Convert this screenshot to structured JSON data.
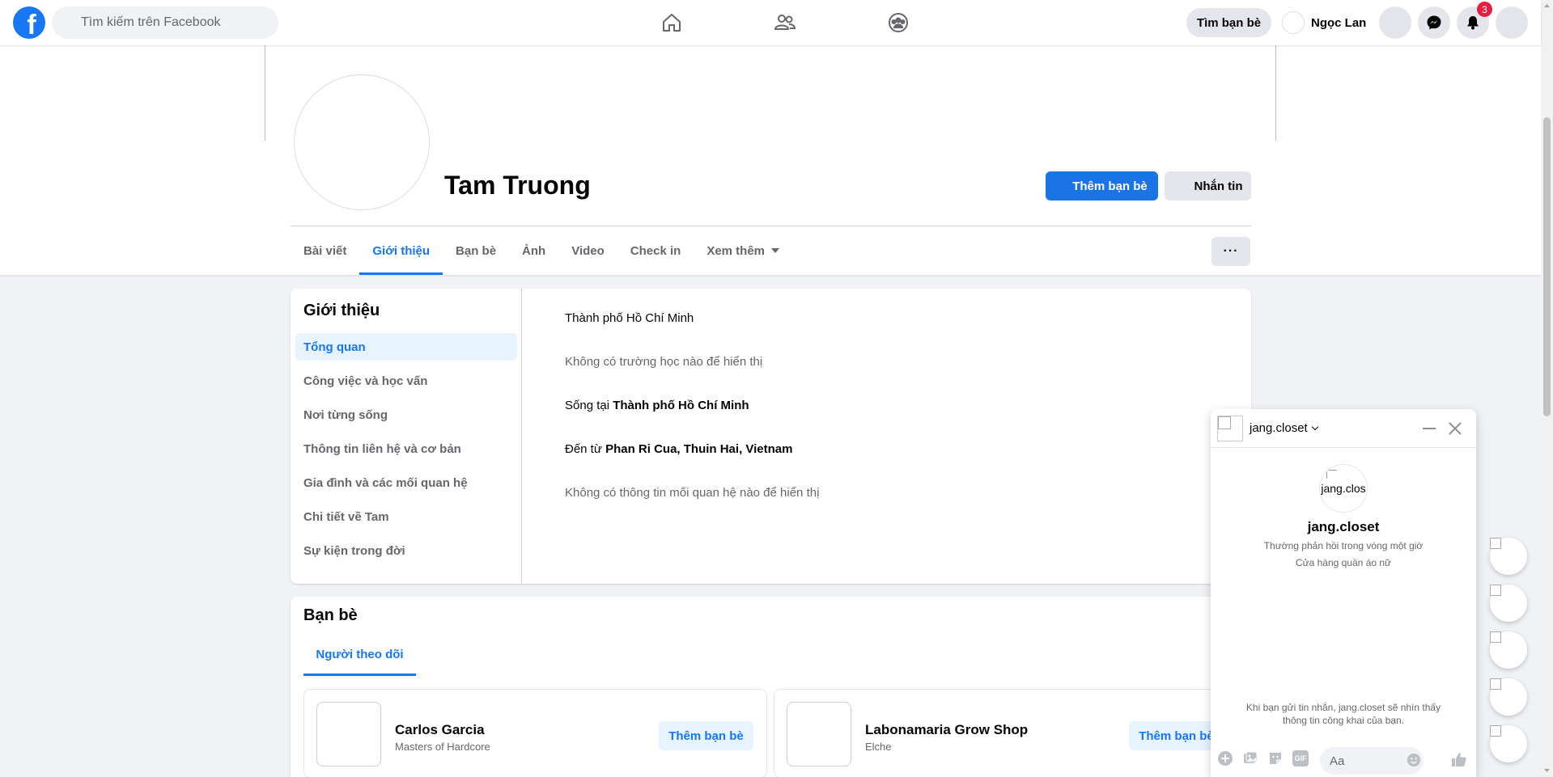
{
  "topbar": {
    "logo_letter": "f",
    "search_placeholder": "Tìm kiếm trên Facebook",
    "find_friends_label": "Tìm bạn bè",
    "user_name": "Ngọc Lan",
    "notification_count": "3",
    "nav_icons": [
      "home-icon",
      "friends-icon",
      "groups-icon"
    ]
  },
  "profile": {
    "name": "Tam Truong",
    "add_friend_label": "Thêm bạn bè",
    "message_label": "Nhắn tin",
    "tabs": [
      "Bài viết",
      "Giới thiệu",
      "Bạn bè",
      "Ảnh",
      "Video",
      "Check in",
      "Xem thêm"
    ],
    "active_tab": "Giới thiệu",
    "more_label": "···"
  },
  "intro": {
    "title": "Giới thiệu",
    "menu": [
      "Tổng quan",
      "Công việc và học vấn",
      "Nơi từng sống",
      "Thông tin liên hệ và cơ bản",
      "Gia đình và các mối quan hệ",
      "Chi tiết về Tam",
      "Sự kiện trong đời"
    ],
    "active_menu": "Tổng quan",
    "rows": {
      "city": "Thành phố Hồ Chí Minh",
      "no_school": "Không có trường học nào để hiển thị",
      "lives_prefix": "Sống tại ",
      "lives_value": "Thành phố Hồ Chí Minh",
      "from_prefix": "Đến từ ",
      "from_value": "Phan Ri Cua, Thuin Hai, Vietnam",
      "no_relationship": "Không có thông tin mối quan hệ nào để hiển thị"
    }
  },
  "friends": {
    "title": "Bạn bè",
    "tab": "Người theo dõi",
    "cards": [
      {
        "name": "Carlos Garcia",
        "sub": "Masters of Hardcore",
        "button": "Thêm bạn bè"
      },
      {
        "name": "Labonamaria Grow Shop",
        "sub": "Elche",
        "button": "Thêm bạn bè"
      }
    ]
  },
  "chat": {
    "name": "jang.closet",
    "avatar_text": "jang.clos",
    "response_note": "Thường phản hồi trong vòng một giờ",
    "category": "Cửa hàng quần áo nữ",
    "privacy_note": "Khi bạn gửi tin nhắn, jang.closet sẽ nhìn thấy thông tin công khai của bạn.",
    "input_placeholder": "Aa",
    "gif_label": "GIF"
  },
  "colors": {
    "accent": "#1877f2",
    "badge": "#e41e3f",
    "background": "#f0f2f5"
  }
}
